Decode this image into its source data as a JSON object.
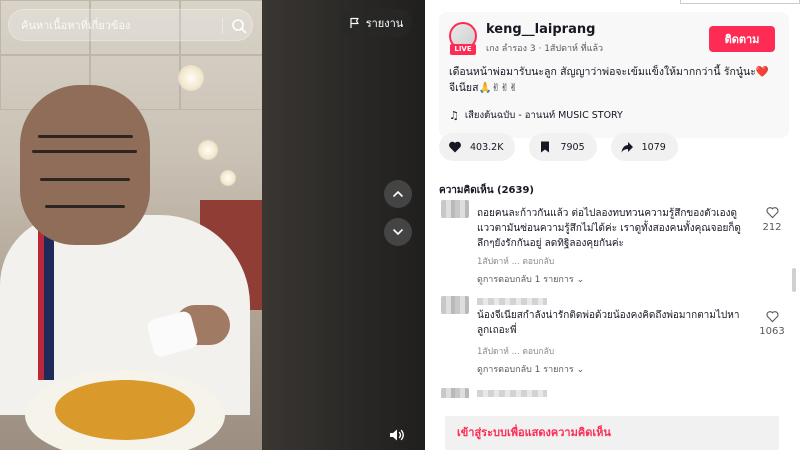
{
  "search": {
    "placeholder": "ค้นหาเนื้อหาที่เกี่ยวข้อง"
  },
  "video": {
    "report_label": "รายงาน"
  },
  "author": {
    "username": "keng__laiprang",
    "live_badge": "LIVE",
    "display_name": "เกง ลำรอง 3",
    "posted": "1สัปดาห์ ที่แล้ว",
    "follow_label": "ติดตาม",
    "caption": "เดือนหน้าพ่อมารับนะลูก สัญญาว่าพ่อจะเข้มแข็งให้มากกว่านี้ รักนู๋นะ❤️ จีเนียส🙏✌✌✌",
    "music": "เสียงต้นฉบับ - อานนท์ MUSIC STORY"
  },
  "stats": {
    "likes": "403.2K",
    "saves": "7905",
    "shares": "1079"
  },
  "comments": {
    "title": "ความคิดเห็น (2639)",
    "items": [
      {
        "text": "ถอยคนละก้าวกันแล้ว ต่อไปลองทบทวนความรู้สึกของตัวเองดู แววตามันซ่อนความรู้สึกไม่ได้ค่ะ เราดูทั้งสองคนทั้งคุณจอยก็ดูลึกๆยังรักกันอยู่ ลดทิฐิลองคุยกันค่ะ",
        "meta": "1สัปดาห์ ... ตอบกลับ",
        "replies": "ดูการตอบกลับ 1 รายการ",
        "likes": "212"
      },
      {
        "text": "น้องจีเนียสกำลังน่ารักติดพ่อด้วยน้องคงคิดถึงพ่อมากตามไปหาลูกเถอะพี่",
        "meta": "1สัปดาห์ ... ตอบกลับ",
        "replies": "ดูการตอบกลับ 1 รายการ",
        "likes": "1063"
      }
    ]
  },
  "login_prompt": "เข้าสู่ระบบเพื่อแสดงความคิดเห็น",
  "colors": {
    "accent": "#fe2c55",
    "panel_bg": "#f8f8f8",
    "pill_bg": "#f1f1f2"
  }
}
